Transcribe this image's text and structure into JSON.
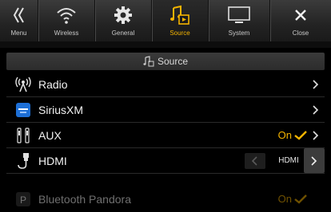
{
  "tabs": [
    {
      "label": "Menu",
      "icon": "menu-back-icon"
    },
    {
      "label": "Wireless",
      "icon": "wireless-icon"
    },
    {
      "label": "General",
      "icon": "gear-icon"
    },
    {
      "label": "Source",
      "icon": "music-note-icon",
      "active": true
    },
    {
      "label": "System",
      "icon": "monitor-icon"
    },
    {
      "label": "Close",
      "icon": "close-icon"
    }
  ],
  "header": {
    "title": "Source",
    "icon": "music-source-icon"
  },
  "rows": {
    "radio": {
      "label": "Radio",
      "icon": "radio-antenna-icon"
    },
    "siriusxm": {
      "label": "SiriusXM",
      "icon": "siriusxm-icon"
    },
    "aux": {
      "label": "AUX",
      "icon": "aux-jack-icon",
      "value": "On",
      "checked": true
    },
    "hdmi": {
      "label": "HDMI",
      "icon": "hdmi-cable-icon",
      "value": "HDMI"
    },
    "pandora": {
      "label": "Bluetooth Pandora",
      "icon": "pandora-icon",
      "value": "On",
      "checked": true
    }
  },
  "colors": {
    "accent": "#f5b400",
    "background": "#000000",
    "bar": "#2c2c2c"
  }
}
